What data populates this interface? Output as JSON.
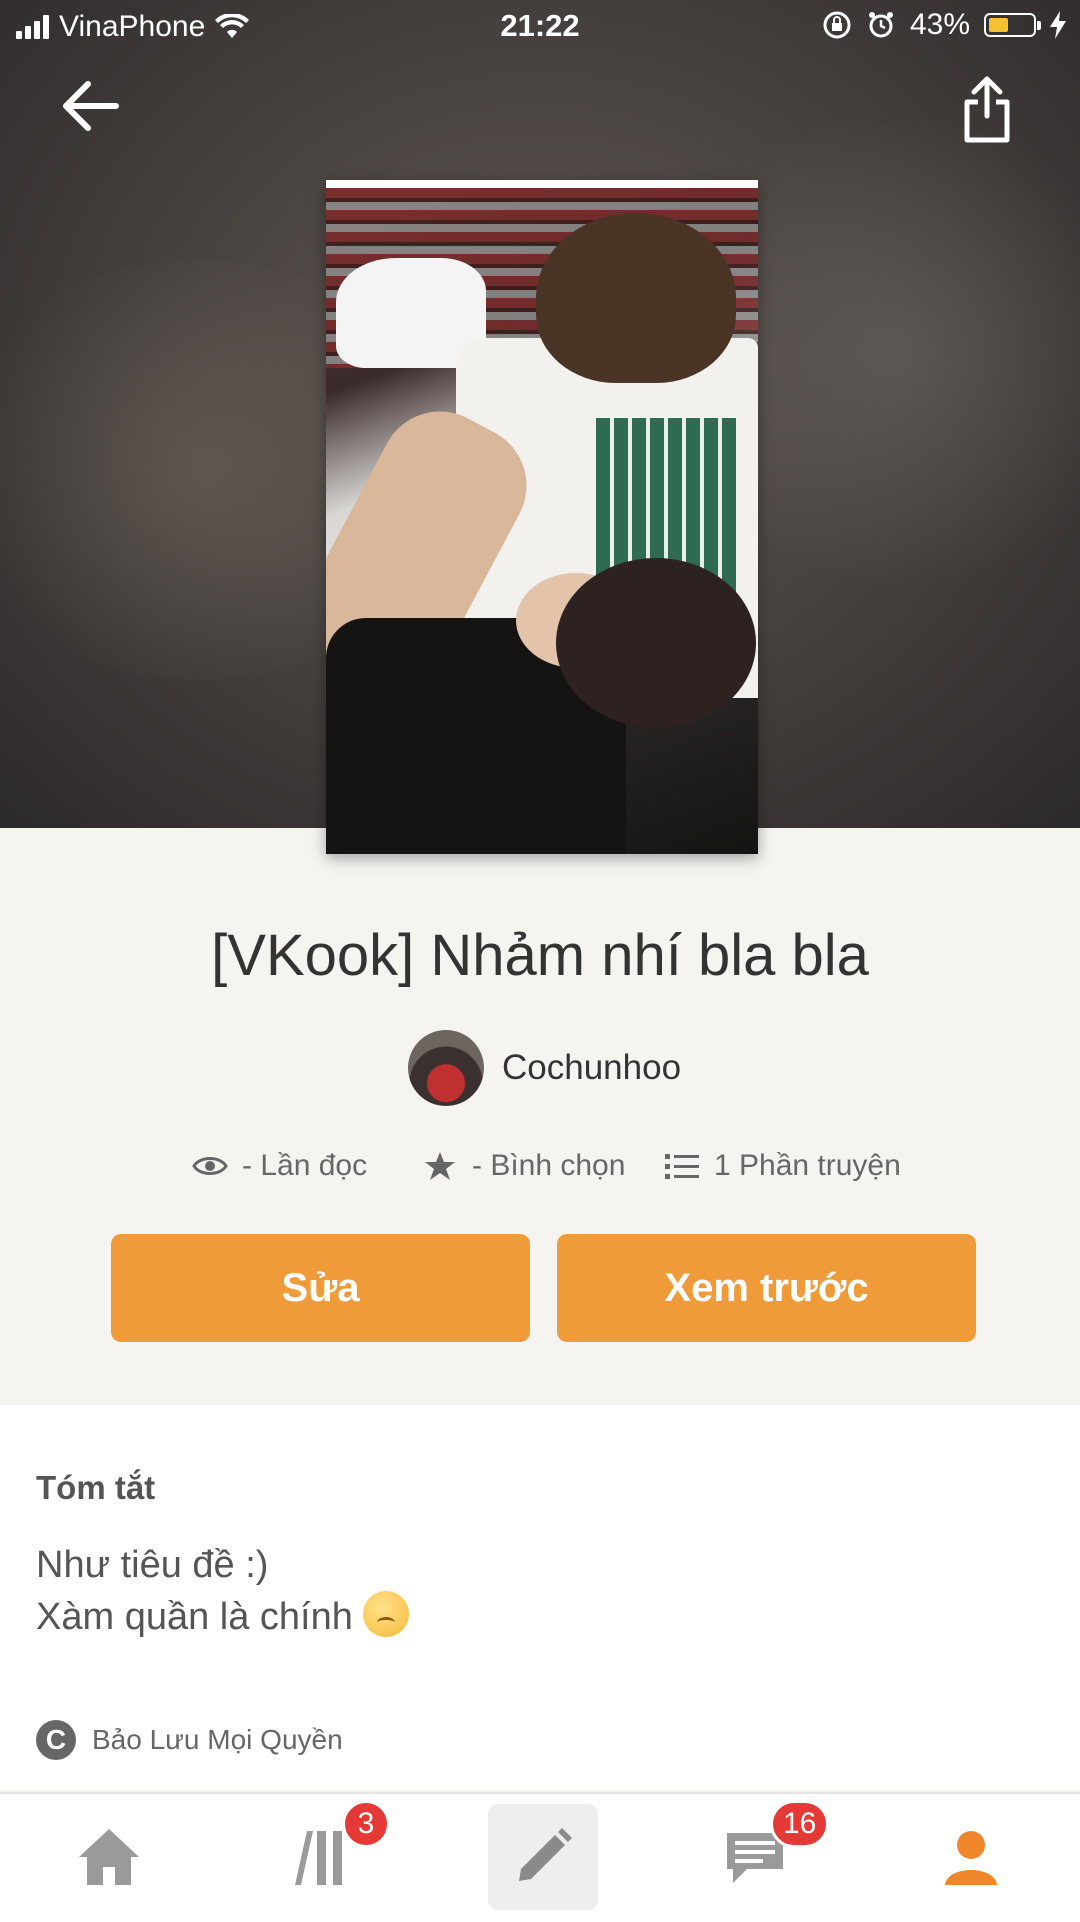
{
  "status_bar": {
    "carrier": "VinaPhone",
    "time": "21:22",
    "battery_percent": "43%",
    "battery_level": 0.43
  },
  "header": {
    "back_icon": "arrow-left-icon",
    "share_icon": "share-icon"
  },
  "story": {
    "title": "[VKook] Nhảm nhí bla bla",
    "author": "Cochunhoo",
    "stats": {
      "reads": "- Lần đọc",
      "votes": "- Bình chọn",
      "parts": "1 Phần truyện"
    }
  },
  "actions": {
    "edit_label": "Sửa",
    "preview_label": "Xem trước"
  },
  "summary": {
    "label": "Tóm tắt",
    "line1": "Như tiêu đề :)",
    "line2": "Xàm quần là chính",
    "copyright": "Bảo Lưu Mọi Quyền"
  },
  "bottom_nav": {
    "items": [
      {
        "icon": "home-icon"
      },
      {
        "icon": "library-icon",
        "badge": "3"
      },
      {
        "icon": "pencil-icon"
      },
      {
        "icon": "messages-icon",
        "badge": "16"
      },
      {
        "icon": "profile-icon"
      }
    ]
  },
  "colors": {
    "accent": "#f09b3a",
    "badge": "#e53935",
    "active_nav": "#f0862a"
  }
}
